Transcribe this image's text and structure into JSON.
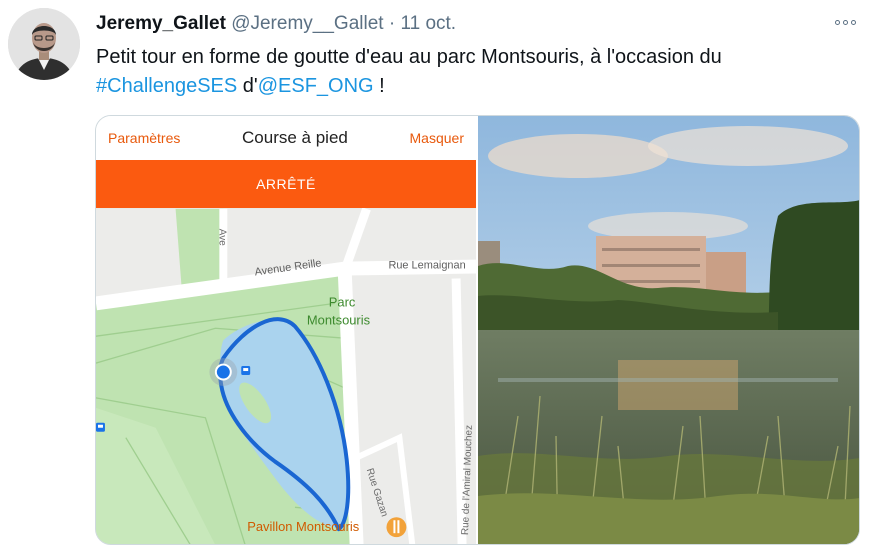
{
  "tweet": {
    "author_name": "Jeremy_Gallet",
    "handle": "@Jeremy__Gallet",
    "separator": "·",
    "date": "11 oct.",
    "text_part1": "Petit tour en forme de goutte d'eau au parc Montsouris, à l'occasion du",
    "hashtag": "#ChallengeSES",
    "text_part2": " d'",
    "mention": "@ESF_ONG",
    "text_part3": " !",
    "more_icon": "more-horizontal-icon"
  },
  "app": {
    "left_label": "Paramètres",
    "title": "Course à pied",
    "right_label": "Masquer",
    "stop_label": "ARRÊTÉ",
    "accent_color": "#fb5a10"
  },
  "map": {
    "street_avenue_top": "Ave",
    "street_reille": "Avenue Reille",
    "street_lemaignan": "Rue Lemaignan",
    "park_name_line1": "Parc",
    "park_name_line2": "Montsouris",
    "street_gazan": "Rue Gazan",
    "street_amiral": "Rue de l'Amiral Mouchez",
    "poi_pavillon": "Pavillon Montsouris",
    "route_color": "#1a66d2"
  }
}
